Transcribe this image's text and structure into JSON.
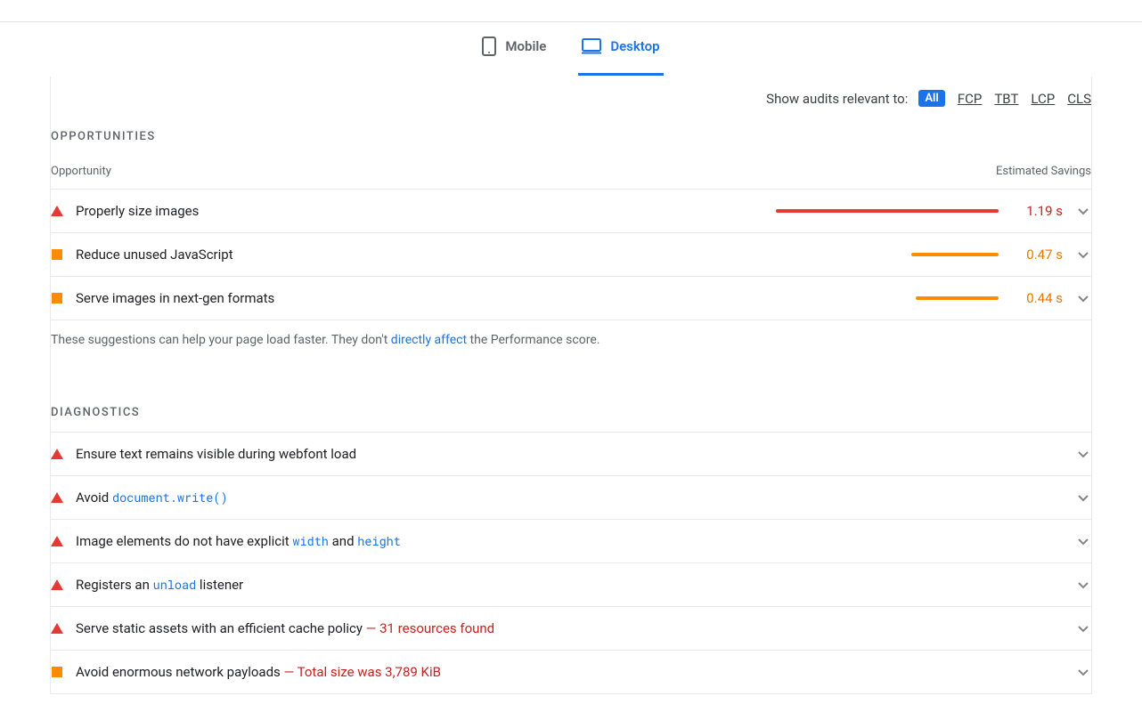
{
  "tabs": {
    "mobile": "Mobile",
    "desktop": "Desktop"
  },
  "filter": {
    "label": "Show audits relevant to:",
    "all": "All",
    "items": [
      "FCP",
      "TBT",
      "LCP",
      "CLS"
    ]
  },
  "opportunities": {
    "title": "OPPORTUNITIES",
    "col_left": "Opportunity",
    "col_right": "Estimated Savings",
    "rows": [
      {
        "severity": "red",
        "label": "Properly size images",
        "bar_color": "red",
        "bar_pct": 100,
        "savings": "1.19 s"
      },
      {
        "severity": "orange",
        "label": "Reduce unused JavaScript",
        "bar_color": "orange",
        "bar_pct": 39,
        "savings": "0.47 s"
      },
      {
        "severity": "orange",
        "label": "Serve images in next-gen formats",
        "bar_color": "orange",
        "bar_pct": 37,
        "savings": "0.44 s"
      }
    ],
    "footnote_pre": "These suggestions can help your page load faster. They don't ",
    "footnote_link": "directly affect",
    "footnote_post": " the Performance score."
  },
  "diagnostics": {
    "title": "DIAGNOSTICS",
    "rows": [
      {
        "severity": "red",
        "parts": [
          {
            "t": "Ensure text remains visible during webfont load"
          }
        ]
      },
      {
        "severity": "red",
        "parts": [
          {
            "t": "Avoid "
          },
          {
            "t": "document.write()",
            "code": true
          }
        ]
      },
      {
        "severity": "red",
        "parts": [
          {
            "t": "Image elements do not have explicit "
          },
          {
            "t": "width",
            "code": true
          },
          {
            "t": " and "
          },
          {
            "t": "height",
            "code": true
          }
        ]
      },
      {
        "severity": "red",
        "parts": [
          {
            "t": "Registers an "
          },
          {
            "t": "unload",
            "code": true
          },
          {
            "t": " listener"
          }
        ]
      },
      {
        "severity": "red",
        "parts": [
          {
            "t": "Serve static assets with an efficient cache policy   "
          },
          {
            "t": "— 31 resources found",
            "em": true
          }
        ]
      },
      {
        "severity": "orange",
        "parts": [
          {
            "t": "Avoid enormous network payloads   "
          },
          {
            "t": "— Total size was 3,789 KiB",
            "em": true
          }
        ]
      }
    ]
  }
}
